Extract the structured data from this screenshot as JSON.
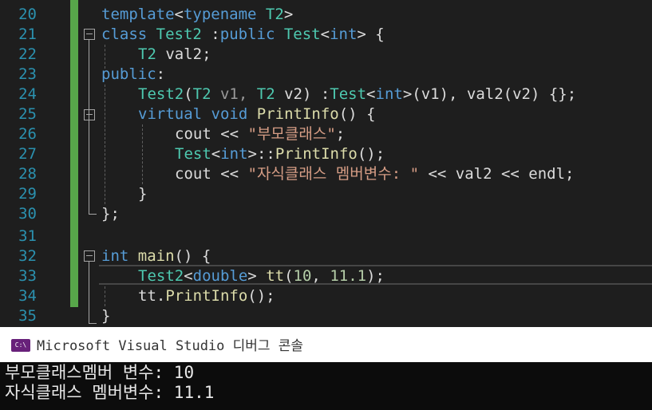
{
  "editor": {
    "line_numbers": [
      "20",
      "21",
      "22",
      "23",
      "24",
      "25",
      "26",
      "27",
      "28",
      "29",
      "30",
      "31",
      "32",
      "33",
      "34",
      "35"
    ],
    "lines": {
      "l20": [
        "template",
        "<",
        "typename",
        " T2",
        ">"
      ],
      "l21": [
        "class",
        " ",
        "Test2",
        " :",
        "public",
        " ",
        "Test",
        "<",
        "int",
        "> {"
      ],
      "l22": [
        "T2",
        " val2;"
      ],
      "l23": [
        "public",
        ":"
      ],
      "l24": [
        "Test2",
        "(",
        "T2",
        " v1, ",
        "T2",
        " v2) :",
        "Test",
        "<",
        "int",
        ">(v1), val2(v2) {};"
      ],
      "l25": [
        "virtual",
        " ",
        "void",
        " ",
        "PrintInfo",
        "() {"
      ],
      "l26": [
        "cout << ",
        "\"부모클래스\"",
        ";"
      ],
      "l27": [
        "Test",
        "<",
        "int",
        ">::",
        "PrintInfo",
        "();"
      ],
      "l28": [
        "cout << ",
        "\"자식클래스 멤버변수: \"",
        " << val2 << endl;"
      ],
      "l29": [
        "}"
      ],
      "l30": [
        "};"
      ],
      "l31": [
        ""
      ],
      "l32": [
        "int",
        " ",
        "main",
        "() {"
      ],
      "l33": [
        "Test2",
        "<",
        "double",
        "> ",
        "tt",
        "(",
        "10",
        ", ",
        "11.1",
        ");"
      ],
      "l34": [
        "tt.",
        "PrintInfo",
        "();"
      ],
      "l35": [
        "}"
      ]
    }
  },
  "console": {
    "title": "Microsoft Visual Studio 디버그 콘솔",
    "icon": "console-app-icon",
    "icon_text": "C:\\",
    "output": [
      "부모클래스멤버 변수: 10",
      "자식클래스 멤버변수: 11.1"
    ]
  },
  "colors": {
    "keyword": "#569cd6",
    "type": "#4ec9b0",
    "function": "#dcdcaa",
    "string": "#d69d85",
    "number": "#b5cea8",
    "line_number": "#2b91af",
    "change_bar": "#57a64a",
    "console_icon": "#68217a"
  }
}
